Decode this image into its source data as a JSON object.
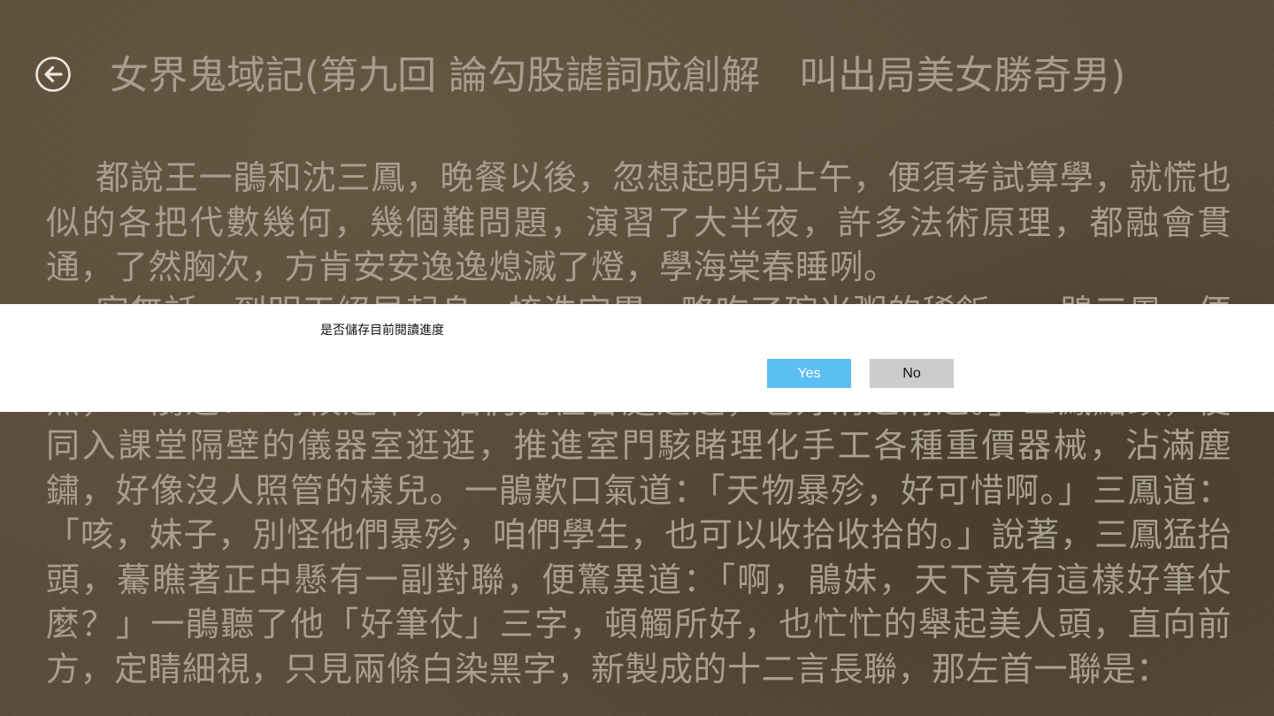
{
  "reader": {
    "title": "女界鬼域記(第九回 論勾股謔詞成創解　叫出局美女勝奇男)",
    "back_icon": "back-arrow-icon",
    "paragraphs": [
      "都說王一鵑和沈三鳳，晚餐以後，忽想起明兒上午，便須考試算學，就慌也似的各把代數幾何，幾個難問題，演習了大半夜，許多法術原理，都融會貫通，了然胸次，方肯安安逸逸熄滅了燈，學海棠春睡咧。",
      "宿無話，到明天絕早起身，梳洗完畢，略吃了碗米粥的稀飯，一鵑三鳳，便手挽手兒，到學堂去。進得學堂，時候尚早，課堂裏空蕩蕩的，半個人影也無，一鵑道：「時候還早，咱們先往各處逛逛，也好消遣消遣。」三鳳點頭，便同入課堂隔壁的儀器室逛逛，推進室門駭睹理化手工各種重價器械，沾滿塵鏽，好像沒人照管的樣兒。一鵑歎口氣道：「天物暴殄，好可惜啊。」三鳳道：「咳，妹子，別怪他們暴殄，咱們學生，也可以收拾收拾的。」說著，三鳳猛抬頭，驀瞧著正中懸有一副對聯，便驚異道：「啊，鵑妹，天下竟有這樣好筆仗麼？」一鵑聽了他「好筆仗」三字，頓觸所好，也忙忙的舉起美人頭，直向前方，定睛細視，只見兩條白染黑字，新製成的十二言長聯，那左首一聯是："
    ]
  },
  "dialog": {
    "message": "是否儲存目前閱讀進度",
    "yes_label": "Yes",
    "no_label": "No"
  },
  "colors": {
    "background": "#5a4d3b",
    "text": "#a99f8f",
    "dialog_background": "#ffffff",
    "yes_button": "#5cbff4",
    "no_button": "#cccccc"
  }
}
